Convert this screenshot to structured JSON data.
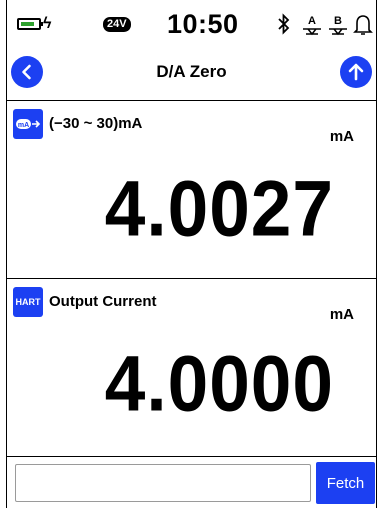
{
  "status_bar": {
    "supply_voltage": "24V",
    "time": "10:50",
    "icons": [
      "battery-charging-icon",
      "bluetooth-icon",
      "alarm-a-icon",
      "alarm-b-icon",
      "bell-icon"
    ]
  },
  "nav": {
    "title": "D/A Zero",
    "back_icon": "back-icon",
    "upload_icon": "upload-icon"
  },
  "panels": [
    {
      "badge_icon": "mA-source-icon",
      "label": "(−30 ~ 30)mA",
      "unit": "mA",
      "value": "4.0027"
    },
    {
      "badge_icon": "hart-icon",
      "badge_text": "HART",
      "label": "Output Current",
      "unit": "mA",
      "value": "4.0000"
    }
  ],
  "bottom": {
    "input_value": "",
    "input_placeholder": "",
    "fetch_label": "Fetch"
  },
  "colors": {
    "accent": "#1c40f2",
    "battery": "#2ea12e"
  }
}
